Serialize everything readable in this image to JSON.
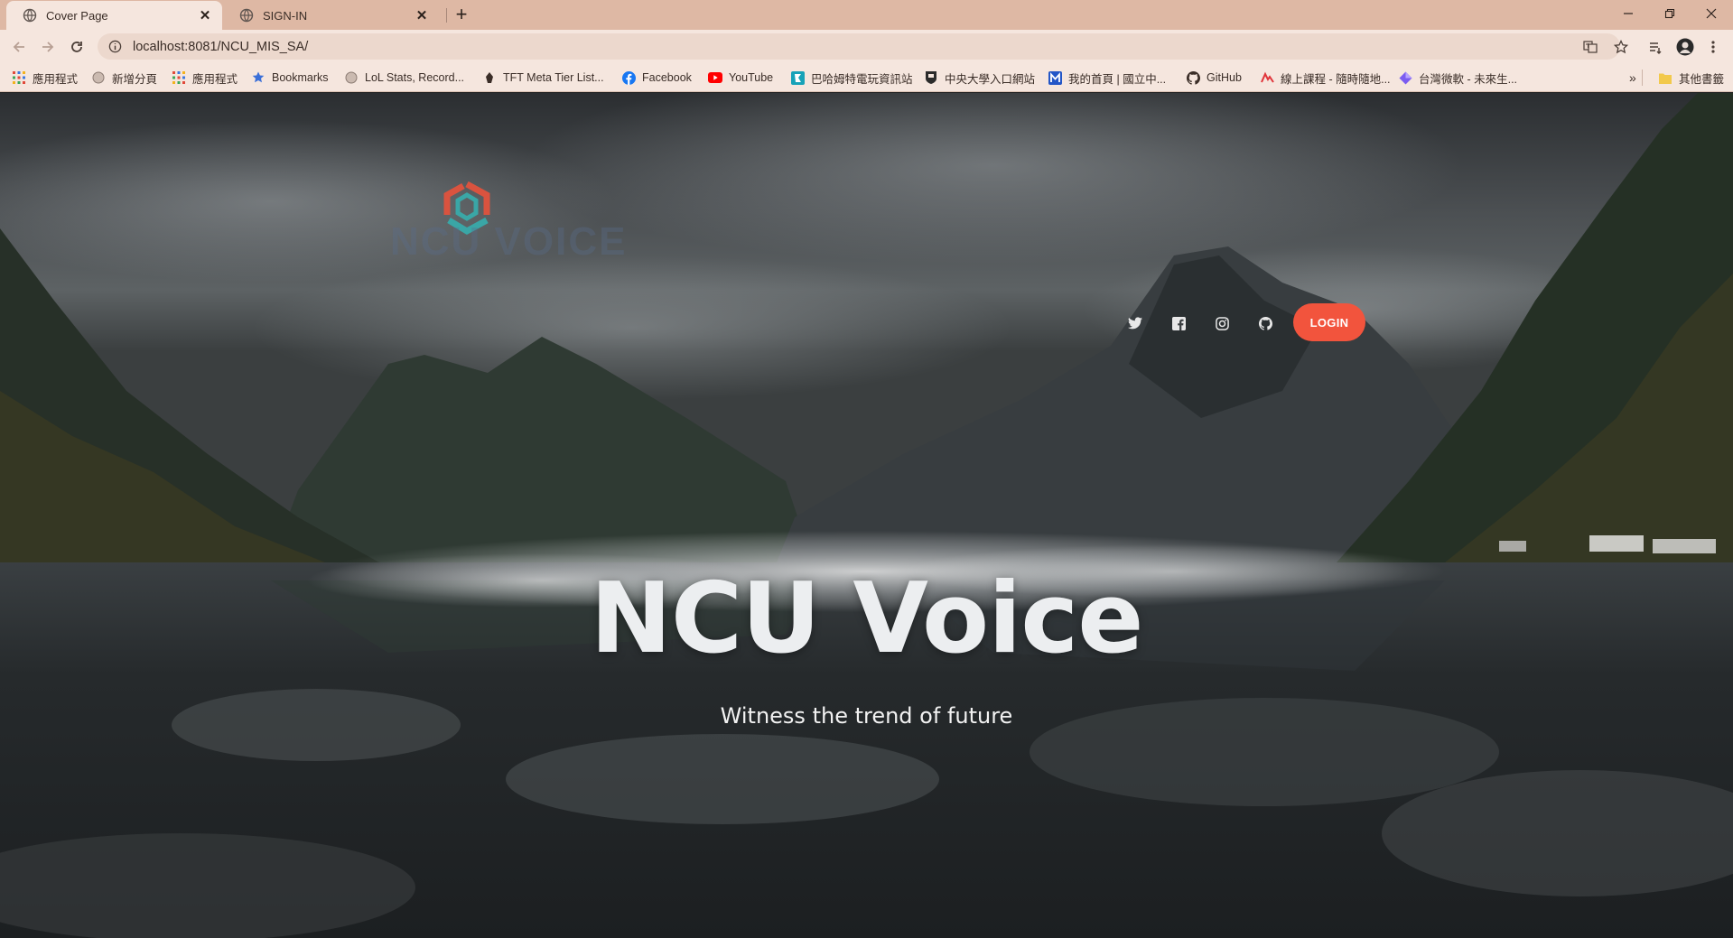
{
  "browser": {
    "tabs": [
      {
        "title": "Cover Page",
        "active": true
      },
      {
        "title": "SIGN-IN",
        "active": false
      }
    ],
    "url": "localhost:8081/NCU_MIS_SA/",
    "bookmarks": [
      {
        "label": "應用程式",
        "icon": "apps-grid-icon"
      },
      {
        "label": "新增分頁",
        "icon": "globe-icon"
      },
      {
        "label": "應用程式",
        "icon": "apps-grid-icon"
      },
      {
        "label": "Bookmarks",
        "icon": "star-icon"
      },
      {
        "label": "LoL Stats, Record...",
        "icon": "globe-icon"
      },
      {
        "label": "TFT Meta Tier List...",
        "icon": "tft-icon"
      },
      {
        "label": "Facebook",
        "icon": "facebook-icon"
      },
      {
        "label": "YouTube",
        "icon": "youtube-icon"
      },
      {
        "label": "巴哈姆特電玩資訊站",
        "icon": "bahamut-icon"
      },
      {
        "label": "中央大學入口網站",
        "icon": "ncu-icon"
      },
      {
        "label": "我的首頁 | 國立中...",
        "icon": "m-icon"
      },
      {
        "label": "GitHub",
        "icon": "github-icon"
      },
      {
        "label": "線上課程 - 隨時隨地...",
        "icon": "course-icon"
      },
      {
        "label": "台灣微軟 - 未來生...",
        "icon": "diamond-icon"
      }
    ],
    "other_bookmarks": "其他書籤",
    "more_bookmarks": "»"
  },
  "page": {
    "title": "NCU Voice",
    "subtitle": "Witness the trend of future",
    "login_label": "LOGIN",
    "social_icons": [
      "twitter-icon",
      "facebook-square-icon",
      "instagram-icon",
      "github-icon"
    ]
  },
  "colors": {
    "tab_strip": "#deb8a4",
    "toolbar": "#f5e6de",
    "login_button": "#f2543d",
    "logo_red": "#d9533f",
    "logo_teal": "#3aa6a6"
  }
}
